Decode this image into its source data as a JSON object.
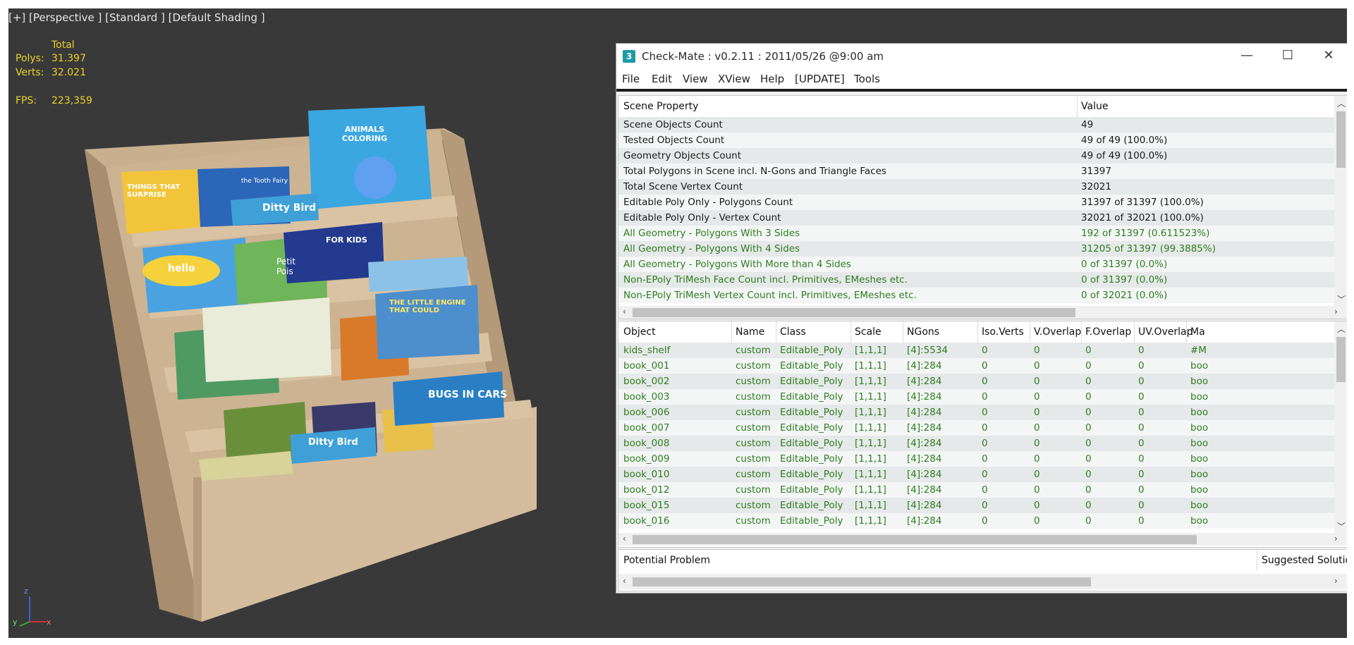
{
  "viewport": {
    "label": "[+] [Perspective ] [Standard ] [Default Shading ]",
    "stats": {
      "total_label": "Total",
      "polys_label": "Polys:",
      "polys_value": "31.397",
      "verts_label": "Verts:",
      "verts_value": "32.021",
      "fps_label": "FPS:",
      "fps_value": "223,359"
    },
    "book_covers": {
      "animals": "ANIMALS COLORING",
      "things": "THINGS THAT SURPRISE",
      "tooth": "the Tooth Fairy",
      "ditty1": "Ditty Bird",
      "hello": "hello",
      "petit": "Petit Pois",
      "kids": "FOR KIDS",
      "engine": "THE LITTLE ENGINE THAT COULD",
      "cars": "BUGS IN CARS",
      "ditty2": "Ditty Bird"
    },
    "axis": {
      "x": "x",
      "y": "y",
      "z": "z"
    }
  },
  "window": {
    "icon": "3",
    "title": "Check-Mate : v0.2.11 : 2011/05/26 @9:00 am",
    "controls": {
      "minimize": "—",
      "maximize": "☐",
      "close": "✕"
    },
    "menu": [
      "File",
      "Edit",
      "View",
      "XView",
      "Help",
      "[UPDATE]",
      "Tools"
    ]
  },
  "scene_table": {
    "headers": [
      "Scene Property",
      "Value"
    ],
    "rows": [
      {
        "property": "Scene Objects Count",
        "value": "49",
        "status": "neutral"
      },
      {
        "property": "Tested Objects Count",
        "value": "49 of 49 (100.0%)",
        "status": "neutral"
      },
      {
        "property": "Geometry Objects Count",
        "value": "49 of 49 (100.0%)",
        "status": "neutral"
      },
      {
        "property": "Total Polygons in Scene incl. N-Gons and Triangle Faces",
        "value": "31397",
        "status": "neutral"
      },
      {
        "property": "Total Scene Vertex Count",
        "value": "32021",
        "status": "neutral"
      },
      {
        "property": "Editable Poly Only - Polygons Count",
        "value": "31397 of 31397 (100.0%)",
        "status": "neutral"
      },
      {
        "property": "Editable Poly Only - Vertex Count",
        "value": "32021 of 32021 (100.0%)",
        "status": "neutral"
      },
      {
        "property": "All Geometry - Polygons With 3 Sides",
        "value": "192 of 31397 (0.611523%)",
        "status": "ok"
      },
      {
        "property": "All Geometry - Polygons With 4 Sides",
        "value": "31205 of 31397 (99.3885%)",
        "status": "ok"
      },
      {
        "property": "All Geometry - Polygons With More than 4 Sides",
        "value": "0 of 31397 (0.0%)",
        "status": "ok"
      },
      {
        "property": "Non-EPoly TriMesh Face Count incl. Primitives, EMeshes etc.",
        "value": "0 of 31397 (0.0%)",
        "status": "ok"
      },
      {
        "property": "Non-EPoly TriMesh Vertex Count incl. Primitives, EMeshes etc.",
        "value": "0 of 32021 (0.0%)",
        "status": "ok"
      }
    ]
  },
  "object_table": {
    "headers": [
      "Object",
      "Name",
      "Class",
      "Scale",
      "NGons",
      "Iso.Verts",
      "V.Overlap",
      "F.Overlap",
      "UV.Overlap",
      "Ma"
    ],
    "rows": [
      [
        "kids_shelf",
        "custom",
        "Editable_Poly",
        "[1,1,1]",
        "[4]:5534",
        "0",
        "0",
        "0",
        "0",
        "#M"
      ],
      [
        "book_001",
        "custom",
        "Editable_Poly",
        "[1,1,1]",
        "[4]:284",
        "0",
        "0",
        "0",
        "0",
        "boo"
      ],
      [
        "book_002",
        "custom",
        "Editable_Poly",
        "[1,1,1]",
        "[4]:284",
        "0",
        "0",
        "0",
        "0",
        "boo"
      ],
      [
        "book_003",
        "custom",
        "Editable_Poly",
        "[1,1,1]",
        "[4]:284",
        "0",
        "0",
        "0",
        "0",
        "boo"
      ],
      [
        "book_006",
        "custom",
        "Editable_Poly",
        "[1,1,1]",
        "[4]:284",
        "0",
        "0",
        "0",
        "0",
        "boo"
      ],
      [
        "book_007",
        "custom",
        "Editable_Poly",
        "[1,1,1]",
        "[4]:284",
        "0",
        "0",
        "0",
        "0",
        "boo"
      ],
      [
        "book_008",
        "custom",
        "Editable_Poly",
        "[1,1,1]",
        "[4]:284",
        "0",
        "0",
        "0",
        "0",
        "boo"
      ],
      [
        "book_009",
        "custom",
        "Editable_Poly",
        "[1,1,1]",
        "[4]:284",
        "0",
        "0",
        "0",
        "0",
        "boo"
      ],
      [
        "book_010",
        "custom",
        "Editable_Poly",
        "[1,1,1]",
        "[4]:284",
        "0",
        "0",
        "0",
        "0",
        "boo"
      ],
      [
        "book_012",
        "custom",
        "Editable_Poly",
        "[1,1,1]",
        "[4]:284",
        "0",
        "0",
        "0",
        "0",
        "boo"
      ],
      [
        "book_015",
        "custom",
        "Editable_Poly",
        "[1,1,1]",
        "[4]:284",
        "0",
        "0",
        "0",
        "0",
        "boo"
      ],
      [
        "book_016",
        "custom",
        "Editable_Poly",
        "[1,1,1]",
        "[4]:284",
        "0",
        "0",
        "0",
        "0",
        "boo"
      ]
    ]
  },
  "problem_table": {
    "headers": [
      "Potential Problem",
      "Suggested Solution"
    ]
  },
  "colors": {
    "ok_text": "#2e7d1f",
    "neutral_text": "#1a1a1a",
    "row_even": "#e6e9e9",
    "row_odd": "#f4f6f6",
    "stats_text": "#e8d22a"
  }
}
